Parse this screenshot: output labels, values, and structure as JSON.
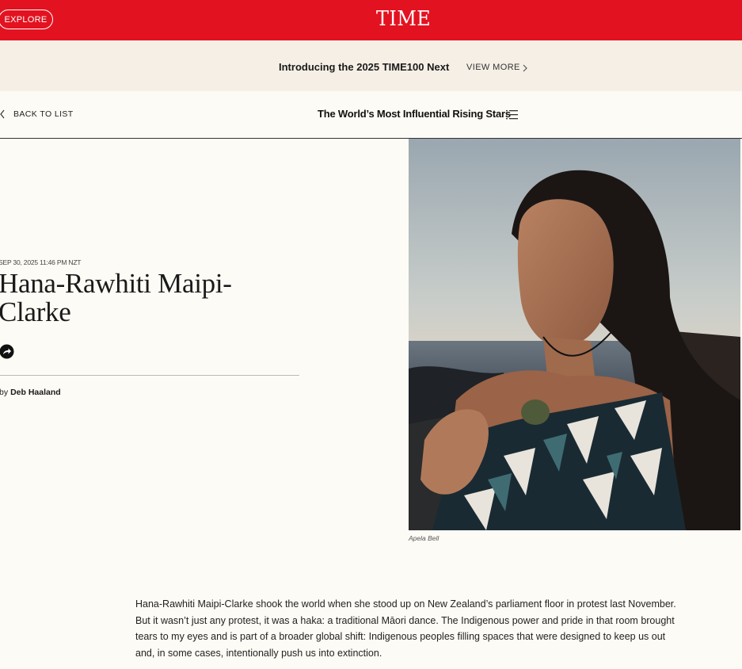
{
  "header": {
    "explore_label": "EXPLORE",
    "logo_text": "TIME",
    "brand_color": "#e31220"
  },
  "promo": {
    "title": "Introducing the 2025 TIME100 Next",
    "link_label": "VIEW MORE"
  },
  "subnav": {
    "back_label": "BACK TO LIST",
    "list_title": "The World’s Most Influential Rising Stars"
  },
  "article": {
    "dateline": "SEP 30, 2025 11:46 PM NZT",
    "headline": "Hana-Rawhiti Maipi-Clarke",
    "byline_prefix": "by",
    "author": "Deb Haaland",
    "photo_credit": "Apela Bell",
    "body": "Hana-Rawhiti Maipi-Clarke shook the world when she stood up on New Zealand’s parliament floor in protest last November. But it wasn’t just any protest, it was a haka: a traditional Māori dance. The Indigenous power and pride in that room brought tears to my eyes and is part of a broader global shift: Indigenous peoples filling spaces that were designed to keep us out and, in some cases, intentionally push us into extinction."
  },
  "icons": {
    "promo_chevron": "chevron-right-icon",
    "back_chevron": "chevron-left-icon",
    "list": "list-icon",
    "share": "share-icon"
  }
}
